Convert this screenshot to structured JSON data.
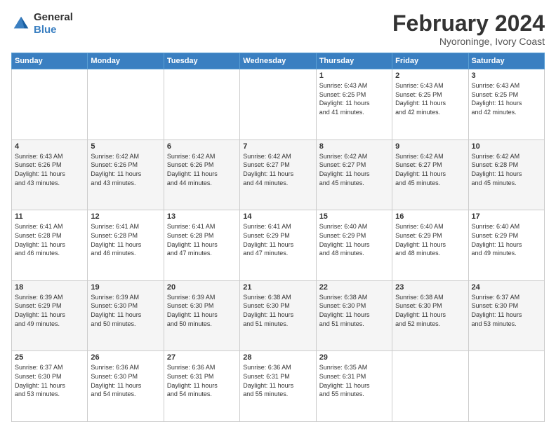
{
  "logo": {
    "general": "General",
    "blue": "Blue"
  },
  "title": {
    "month": "February 2024",
    "location": "Nyoroninge, Ivory Coast"
  },
  "weekdays": [
    "Sunday",
    "Monday",
    "Tuesday",
    "Wednesday",
    "Thursday",
    "Friday",
    "Saturday"
  ],
  "weeks": [
    [
      {
        "day": "",
        "info": ""
      },
      {
        "day": "",
        "info": ""
      },
      {
        "day": "",
        "info": ""
      },
      {
        "day": "",
        "info": ""
      },
      {
        "day": "1",
        "info": "Sunrise: 6:43 AM\nSunset: 6:25 PM\nDaylight: 11 hours\nand 41 minutes."
      },
      {
        "day": "2",
        "info": "Sunrise: 6:43 AM\nSunset: 6:25 PM\nDaylight: 11 hours\nand 42 minutes."
      },
      {
        "day": "3",
        "info": "Sunrise: 6:43 AM\nSunset: 6:25 PM\nDaylight: 11 hours\nand 42 minutes."
      }
    ],
    [
      {
        "day": "4",
        "info": "Sunrise: 6:43 AM\nSunset: 6:26 PM\nDaylight: 11 hours\nand 43 minutes."
      },
      {
        "day": "5",
        "info": "Sunrise: 6:42 AM\nSunset: 6:26 PM\nDaylight: 11 hours\nand 43 minutes."
      },
      {
        "day": "6",
        "info": "Sunrise: 6:42 AM\nSunset: 6:26 PM\nDaylight: 11 hours\nand 44 minutes."
      },
      {
        "day": "7",
        "info": "Sunrise: 6:42 AM\nSunset: 6:27 PM\nDaylight: 11 hours\nand 44 minutes."
      },
      {
        "day": "8",
        "info": "Sunrise: 6:42 AM\nSunset: 6:27 PM\nDaylight: 11 hours\nand 45 minutes."
      },
      {
        "day": "9",
        "info": "Sunrise: 6:42 AM\nSunset: 6:27 PM\nDaylight: 11 hours\nand 45 minutes."
      },
      {
        "day": "10",
        "info": "Sunrise: 6:42 AM\nSunset: 6:28 PM\nDaylight: 11 hours\nand 45 minutes."
      }
    ],
    [
      {
        "day": "11",
        "info": "Sunrise: 6:41 AM\nSunset: 6:28 PM\nDaylight: 11 hours\nand 46 minutes."
      },
      {
        "day": "12",
        "info": "Sunrise: 6:41 AM\nSunset: 6:28 PM\nDaylight: 11 hours\nand 46 minutes."
      },
      {
        "day": "13",
        "info": "Sunrise: 6:41 AM\nSunset: 6:28 PM\nDaylight: 11 hours\nand 47 minutes."
      },
      {
        "day": "14",
        "info": "Sunrise: 6:41 AM\nSunset: 6:29 PM\nDaylight: 11 hours\nand 47 minutes."
      },
      {
        "day": "15",
        "info": "Sunrise: 6:40 AM\nSunset: 6:29 PM\nDaylight: 11 hours\nand 48 minutes."
      },
      {
        "day": "16",
        "info": "Sunrise: 6:40 AM\nSunset: 6:29 PM\nDaylight: 11 hours\nand 48 minutes."
      },
      {
        "day": "17",
        "info": "Sunrise: 6:40 AM\nSunset: 6:29 PM\nDaylight: 11 hours\nand 49 minutes."
      }
    ],
    [
      {
        "day": "18",
        "info": "Sunrise: 6:39 AM\nSunset: 6:29 PM\nDaylight: 11 hours\nand 49 minutes."
      },
      {
        "day": "19",
        "info": "Sunrise: 6:39 AM\nSunset: 6:30 PM\nDaylight: 11 hours\nand 50 minutes."
      },
      {
        "day": "20",
        "info": "Sunrise: 6:39 AM\nSunset: 6:30 PM\nDaylight: 11 hours\nand 50 minutes."
      },
      {
        "day": "21",
        "info": "Sunrise: 6:38 AM\nSunset: 6:30 PM\nDaylight: 11 hours\nand 51 minutes."
      },
      {
        "day": "22",
        "info": "Sunrise: 6:38 AM\nSunset: 6:30 PM\nDaylight: 11 hours\nand 51 minutes."
      },
      {
        "day": "23",
        "info": "Sunrise: 6:38 AM\nSunset: 6:30 PM\nDaylight: 11 hours\nand 52 minutes."
      },
      {
        "day": "24",
        "info": "Sunrise: 6:37 AM\nSunset: 6:30 PM\nDaylight: 11 hours\nand 53 minutes."
      }
    ],
    [
      {
        "day": "25",
        "info": "Sunrise: 6:37 AM\nSunset: 6:30 PM\nDaylight: 11 hours\nand 53 minutes."
      },
      {
        "day": "26",
        "info": "Sunrise: 6:36 AM\nSunset: 6:30 PM\nDaylight: 11 hours\nand 54 minutes."
      },
      {
        "day": "27",
        "info": "Sunrise: 6:36 AM\nSunset: 6:31 PM\nDaylight: 11 hours\nand 54 minutes."
      },
      {
        "day": "28",
        "info": "Sunrise: 6:36 AM\nSunset: 6:31 PM\nDaylight: 11 hours\nand 55 minutes."
      },
      {
        "day": "29",
        "info": "Sunrise: 6:35 AM\nSunset: 6:31 PM\nDaylight: 11 hours\nand 55 minutes."
      },
      {
        "day": "",
        "info": ""
      },
      {
        "day": "",
        "info": ""
      }
    ]
  ]
}
